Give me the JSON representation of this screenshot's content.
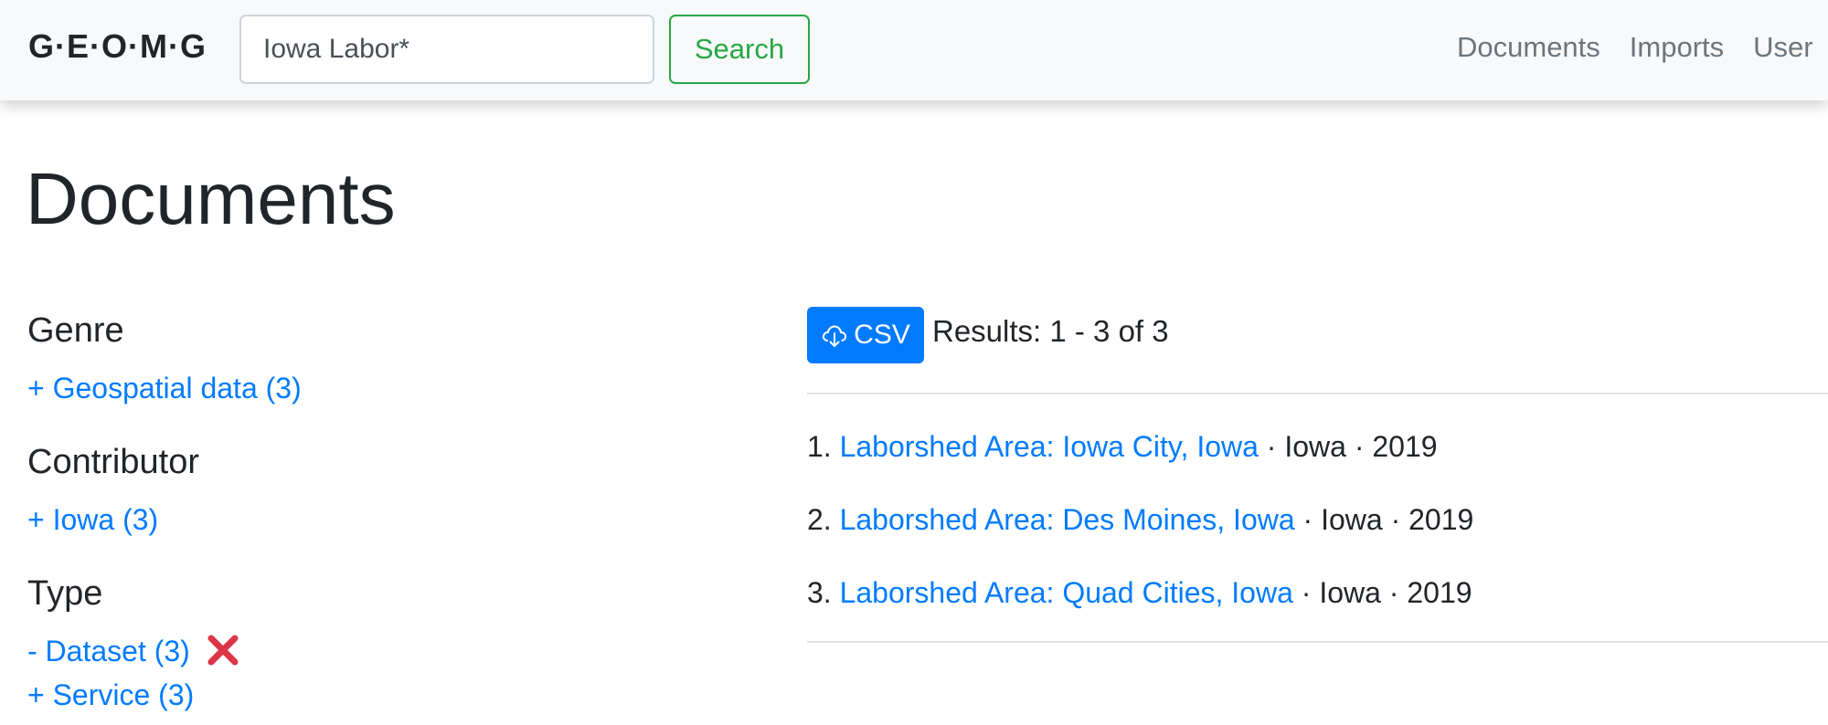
{
  "navbar": {
    "brand": "G·E·O·M·G",
    "search_value": "Iowa Labor*",
    "search_button": "Search",
    "links": [
      "Documents",
      "Imports",
      "User"
    ]
  },
  "page": {
    "title": "Documents"
  },
  "facets": {
    "genre": {
      "heading": "Genre",
      "items": [
        "+ Geospatial data (3)"
      ]
    },
    "contributor": {
      "heading": "Contributor",
      "items": [
        "+ Iowa (3)"
      ]
    },
    "type": {
      "heading": "Type",
      "items": [
        "- Dataset (3)",
        "+ Service (3)"
      ]
    }
  },
  "results": {
    "csv_label": "CSV",
    "count_text": "Results: 1 - 3 of 3",
    "items": [
      {
        "num": "1.",
        "title": "Laborshed Area: Iowa City, Iowa",
        "meta": " · Iowa · 2019"
      },
      {
        "num": "2.",
        "title": "Laborshed Area: Des Moines, Iowa",
        "meta": " · Iowa · 2019"
      },
      {
        "num": "3.",
        "title": "Laborshed Area: Quad Cities, Iowa",
        "meta": " · Iowa · 2019"
      }
    ]
  },
  "colors": {
    "link": "#007bff",
    "success": "#28a745",
    "remove": "#dc3545"
  },
  "icons": {
    "csv": "cloud-download-icon",
    "remove_facet": "close-icon"
  }
}
